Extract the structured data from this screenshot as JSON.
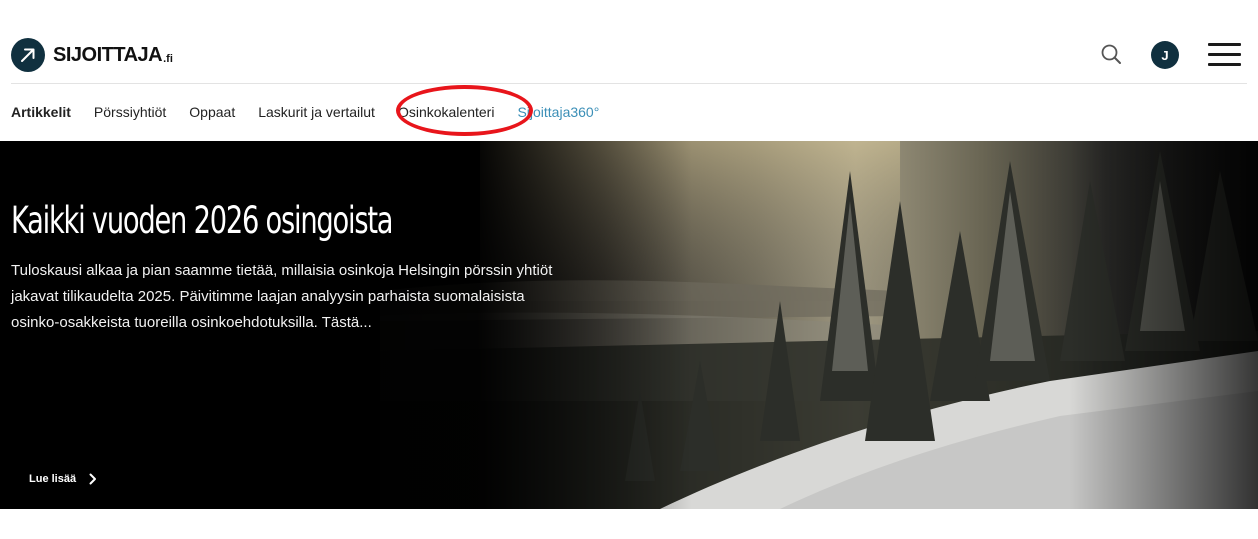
{
  "brand": {
    "name": "SIJOITTAJA",
    "tld": ".fi"
  },
  "header": {
    "icons": {
      "logo": "arrow-up-right-icon",
      "search": "search-icon",
      "menu": "hamburger-menu-icon"
    },
    "user_initial": "J",
    "colors": {
      "brand": "#10303f",
      "accent": "#3b8fb7",
      "highlight": "#e8151b"
    }
  },
  "nav": {
    "items": [
      {
        "label": "Artikkelit"
      },
      {
        "label": "Pörssiyhtiöt"
      },
      {
        "label": "Oppaat"
      },
      {
        "label": "Laskurit ja vertailut"
      },
      {
        "label": "Osinkokalenteri"
      },
      {
        "label": "Sijoittaja360°"
      }
    ]
  },
  "hero": {
    "title": "Kaikki vuoden 2026 osingoista",
    "text": "Tuloskausi alkaa ja pian saamme tietää, millaisia osinkoja Helsingin pörssin yhtiöt jakavat tilikaudelta 2025. Päivitimme laajan analyysin parhaista suomalaisista osinko-osakkeista tuoreilla osinkoehdotuksilla. Tästä...",
    "read_more": "Lue lisää",
    "read_more_icon": "chevron-right-icon"
  }
}
